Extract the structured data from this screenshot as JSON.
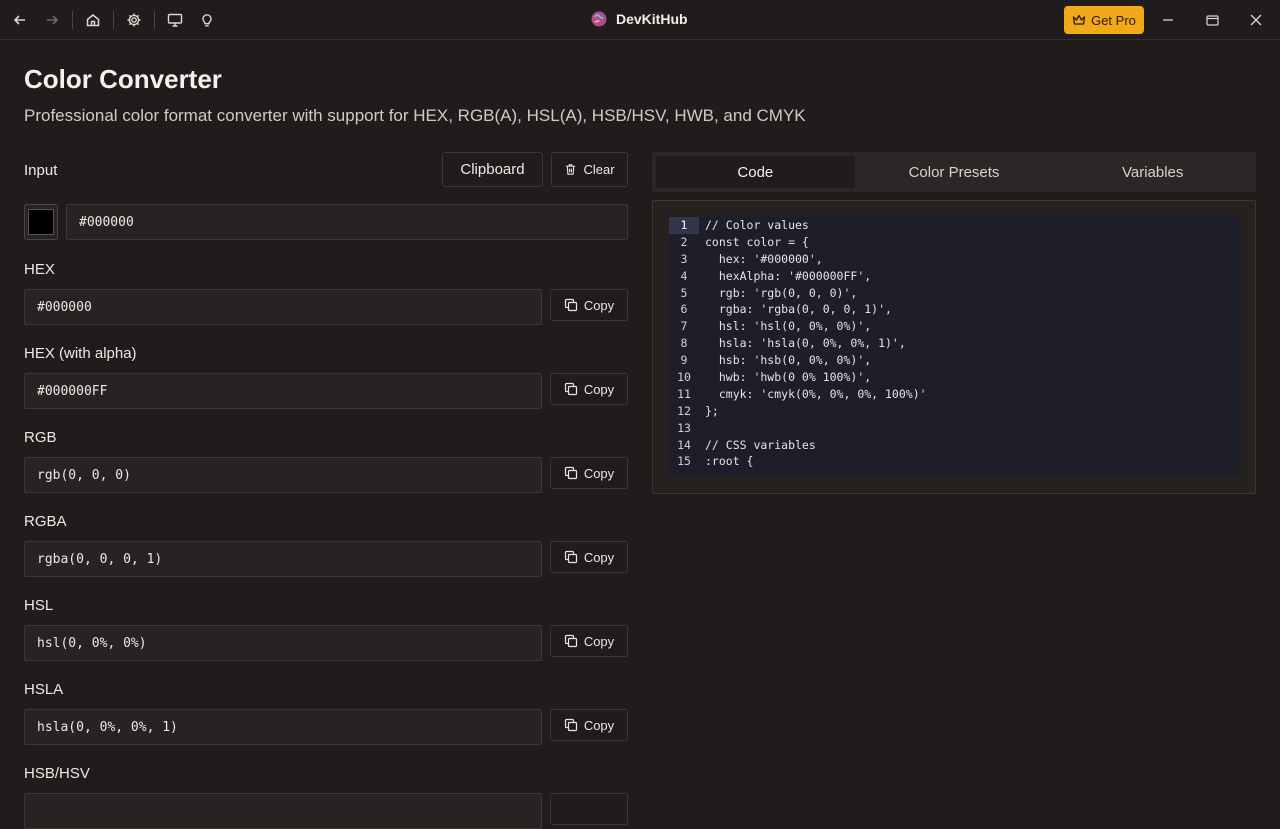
{
  "app": {
    "title": "DevKitHub",
    "get_pro_label": "Get Pro"
  },
  "toolbar_icons": [
    "back-arrow-icon",
    "forward-arrow-icon",
    "home-icon",
    "gear-icon",
    "monitor-icon",
    "lightbulb-icon"
  ],
  "page": {
    "title": "Color Converter",
    "subtitle": "Professional color format converter with support for HEX, RGB(A), HSL(A), HSB/HSV, HWB, and CMYK"
  },
  "input": {
    "label": "Input",
    "clipboard_label": "Clipboard",
    "clear_label": "Clear",
    "value": "#000000",
    "swatch_color": "#000000"
  },
  "copy_label": "Copy",
  "formats": [
    {
      "label": "HEX",
      "value": "#000000"
    },
    {
      "label": "HEX (with alpha)",
      "value": "#000000FF"
    },
    {
      "label": "RGB",
      "value": "rgb(0, 0, 0)"
    },
    {
      "label": "RGBA",
      "value": "rgba(0, 0, 0, 1)"
    },
    {
      "label": "HSL",
      "value": "hsl(0, 0%, 0%)"
    },
    {
      "label": "HSLA",
      "value": "hsla(0, 0%, 0%, 1)"
    },
    {
      "label": "HSB/HSV",
      "value": ""
    }
  ],
  "tabs": [
    {
      "label": "Code",
      "active": true
    },
    {
      "label": "Color Presets",
      "active": false
    },
    {
      "label": "Variables",
      "active": false
    }
  ],
  "code": {
    "current_line": 1,
    "lines": [
      "// Color values",
      "const color = {",
      "  hex: '#000000',",
      "  hexAlpha: '#000000FF',",
      "  rgb: 'rgb(0, 0, 0)',",
      "  rgba: 'rgba(0, 0, 0, 1)',",
      "  hsl: 'hsl(0, 0%, 0%)',",
      "  hsla: 'hsla(0, 0%, 0%, 1)',",
      "  hsb: 'hsb(0, 0%, 0%)',",
      "  hwb: 'hwb(0 0% 100%)',",
      "  cmyk: 'cmyk(0%, 0%, 0%, 100%)'",
      "};",
      "",
      "// CSS variables",
      ":root {"
    ]
  },
  "colors": {
    "background": "#1f1c1b",
    "accent_pro": "#f3a81a",
    "code_background": "#1e1e2a"
  }
}
